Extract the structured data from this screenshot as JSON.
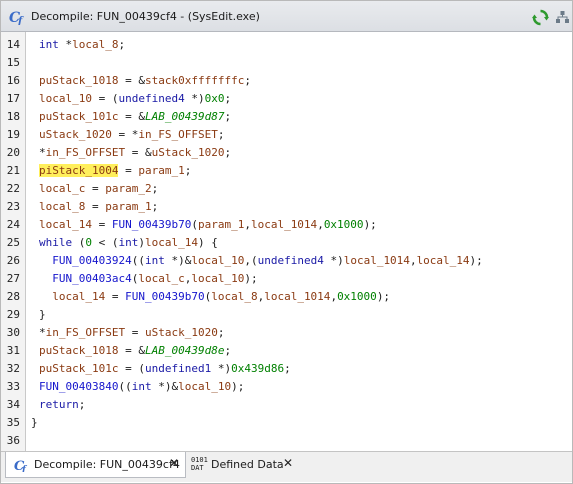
{
  "window": {
    "title": "Decompile: FUN_00439cf4 -  (SysEdit.exe)"
  },
  "editor": {
    "lines": [
      {
        "num": "14",
        "tokens": [
          {
            "t": "int",
            "c": "ty"
          },
          {
            "t": " *",
            "c": "p"
          },
          {
            "t": "local_8",
            "c": "v"
          },
          {
            "t": ";",
            "c": "p"
          }
        ]
      },
      {
        "num": "15",
        "tokens": []
      },
      {
        "num": "16",
        "tokens": [
          {
            "t": "puStack_1018",
            "c": "v"
          },
          {
            "t": " = &",
            "c": "p"
          },
          {
            "t": "stack0xfffffffc",
            "c": "v"
          },
          {
            "t": ";",
            "c": "p"
          }
        ]
      },
      {
        "num": "17",
        "tokens": [
          {
            "t": "local_10",
            "c": "v"
          },
          {
            "t": " = (",
            "c": "p"
          },
          {
            "t": "undefined4",
            "c": "ty"
          },
          {
            "t": " *)",
            "c": "p"
          },
          {
            "t": "0x0",
            "c": "n"
          },
          {
            "t": ";",
            "c": "p"
          }
        ]
      },
      {
        "num": "18",
        "tokens": [
          {
            "t": "puStack_101c",
            "c": "v"
          },
          {
            "t": " = &",
            "c": "p"
          },
          {
            "t": "LAB_00439d87",
            "c": "lb"
          },
          {
            "t": ";",
            "c": "p"
          }
        ]
      },
      {
        "num": "19",
        "tokens": [
          {
            "t": "uStack_1020",
            "c": "v"
          },
          {
            "t": " = *",
            "c": "p"
          },
          {
            "t": "in_FS_OFFSET",
            "c": "v"
          },
          {
            "t": ";",
            "c": "p"
          }
        ]
      },
      {
        "num": "20",
        "tokens": [
          {
            "t": "*",
            "c": "p"
          },
          {
            "t": "in_FS_OFFSET",
            "c": "v"
          },
          {
            "t": " = &",
            "c": "p"
          },
          {
            "t": "uStack_1020",
            "c": "v"
          },
          {
            "t": ";",
            "c": "p"
          }
        ]
      },
      {
        "num": "21",
        "tokens": [
          {
            "t": "piStack_1004",
            "c": "v",
            "hl": true
          },
          {
            "t": " = ",
            "c": "p"
          },
          {
            "t": "param_1",
            "c": "v"
          },
          {
            "t": ";",
            "c": "p"
          }
        ]
      },
      {
        "num": "22",
        "tokens": [
          {
            "t": "local_c",
            "c": "v"
          },
          {
            "t": " = ",
            "c": "p"
          },
          {
            "t": "param_2",
            "c": "v"
          },
          {
            "t": ";",
            "c": "p"
          }
        ]
      },
      {
        "num": "23",
        "tokens": [
          {
            "t": "local_8",
            "c": "v"
          },
          {
            "t": " = ",
            "c": "p"
          },
          {
            "t": "param_1",
            "c": "v"
          },
          {
            "t": ";",
            "c": "p"
          }
        ]
      },
      {
        "num": "24",
        "tokens": [
          {
            "t": "local_14",
            "c": "v"
          },
          {
            "t": " = ",
            "c": "p"
          },
          {
            "t": "FUN_00439b70",
            "c": "f"
          },
          {
            "t": "(",
            "c": "p"
          },
          {
            "t": "param_1",
            "c": "v"
          },
          {
            "t": ",",
            "c": "p"
          },
          {
            "t": "local_1014",
            "c": "v"
          },
          {
            "t": ",",
            "c": "p"
          },
          {
            "t": "0x1000",
            "c": "n"
          },
          {
            "t": ");",
            "c": "p"
          }
        ]
      },
      {
        "num": "25",
        "tokens": [
          {
            "t": "while",
            "c": "kw"
          },
          {
            "t": " (",
            "c": "p"
          },
          {
            "t": "0",
            "c": "n"
          },
          {
            "t": " < (",
            "c": "p"
          },
          {
            "t": "int",
            "c": "ty"
          },
          {
            "t": ")",
            "c": "p"
          },
          {
            "t": "local_14",
            "c": "v"
          },
          {
            "t": ") {",
            "c": "p"
          }
        ]
      },
      {
        "num": "26",
        "tokens": [
          {
            "t": "  ",
            "c": "p"
          },
          {
            "t": "FUN_00403924",
            "c": "f"
          },
          {
            "t": "((",
            "c": "p"
          },
          {
            "t": "int",
            "c": "ty"
          },
          {
            "t": " *)&",
            "c": "p"
          },
          {
            "t": "local_10",
            "c": "v"
          },
          {
            "t": ",(",
            "c": "p"
          },
          {
            "t": "undefined4",
            "c": "ty"
          },
          {
            "t": " *)",
            "c": "p"
          },
          {
            "t": "local_1014",
            "c": "v"
          },
          {
            "t": ",",
            "c": "p"
          },
          {
            "t": "local_14",
            "c": "v"
          },
          {
            "t": ");",
            "c": "p"
          }
        ]
      },
      {
        "num": "27",
        "tokens": [
          {
            "t": "  ",
            "c": "p"
          },
          {
            "t": "FUN_00403ac4",
            "c": "f"
          },
          {
            "t": "(",
            "c": "p"
          },
          {
            "t": "local_c",
            "c": "v"
          },
          {
            "t": ",",
            "c": "p"
          },
          {
            "t": "local_10",
            "c": "v"
          },
          {
            "t": ");",
            "c": "p"
          }
        ]
      },
      {
        "num": "28",
        "tokens": [
          {
            "t": "  ",
            "c": "p"
          },
          {
            "t": "local_14",
            "c": "v"
          },
          {
            "t": " = ",
            "c": "p"
          },
          {
            "t": "FUN_00439b70",
            "c": "f"
          },
          {
            "t": "(",
            "c": "p"
          },
          {
            "t": "local_8",
            "c": "v"
          },
          {
            "t": ",",
            "c": "p"
          },
          {
            "t": "local_1014",
            "c": "v"
          },
          {
            "t": ",",
            "c": "p"
          },
          {
            "t": "0x1000",
            "c": "n"
          },
          {
            "t": ");",
            "c": "p"
          }
        ]
      },
      {
        "num": "29",
        "tokens": [
          {
            "t": "}",
            "c": "p"
          }
        ]
      },
      {
        "num": "30",
        "tokens": [
          {
            "t": "*",
            "c": "p"
          },
          {
            "t": "in_FS_OFFSET",
            "c": "v"
          },
          {
            "t": " = ",
            "c": "p"
          },
          {
            "t": "uStack_1020",
            "c": "v"
          },
          {
            "t": ";",
            "c": "p"
          }
        ]
      },
      {
        "num": "31",
        "tokens": [
          {
            "t": "puStack_1018",
            "c": "v"
          },
          {
            "t": " = &",
            "c": "p"
          },
          {
            "t": "LAB_00439d8e",
            "c": "lb"
          },
          {
            "t": ";",
            "c": "p"
          }
        ]
      },
      {
        "num": "32",
        "tokens": [
          {
            "t": "puStack_101c",
            "c": "v"
          },
          {
            "t": " = (",
            "c": "p"
          },
          {
            "t": "undefined1",
            "c": "ty"
          },
          {
            "t": " *)",
            "c": "p"
          },
          {
            "t": "0x439d86",
            "c": "n"
          },
          {
            "t": ";",
            "c": "p"
          }
        ]
      },
      {
        "num": "33",
        "tokens": [
          {
            "t": "FUN_00403840",
            "c": "f"
          },
          {
            "t": "((",
            "c": "p"
          },
          {
            "t": "int",
            "c": "ty"
          },
          {
            "t": " *)&",
            "c": "p"
          },
          {
            "t": "local_10",
            "c": "v"
          },
          {
            "t": ");",
            "c": "p"
          }
        ]
      },
      {
        "num": "34",
        "tokens": [
          {
            "t": "return",
            "c": "kw"
          },
          {
            "t": ";",
            "c": "p"
          }
        ]
      },
      {
        "num": "35",
        "tokens": [
          {
            "t": "}",
            "c": "p"
          }
        ],
        "flush": true
      },
      {
        "num": "36",
        "tokens": []
      }
    ]
  },
  "tabs": [
    {
      "label": "Decompile: FUN_00439cf4",
      "icon": "decompile-icon",
      "close": "✕",
      "active": true
    },
    {
      "label": "Defined Data",
      "icon_text": "0101\nDAT",
      "icon": "data-icon",
      "close": "✕",
      "active": false
    }
  ],
  "colors": {
    "variable": "#8a3a12",
    "function": "#1515cc",
    "type": "#1a1aa6",
    "number": "#008000",
    "highlight": "#ffef5c"
  }
}
